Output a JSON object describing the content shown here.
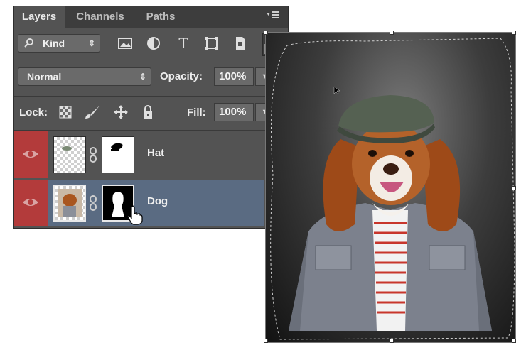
{
  "layers_panel": {
    "tabs": [
      "Layers",
      "Channels",
      "Paths"
    ],
    "active_tab": "Layers",
    "filter": {
      "kind_label": "Kind"
    },
    "blend_mode": "Normal",
    "opacity_label": "Opacity:",
    "opacity_value": "100%",
    "lock_label": "Lock:",
    "fill_label": "Fill:",
    "fill_value": "100%",
    "layers": [
      {
        "name": "Hat",
        "visible": true,
        "selected": false
      },
      {
        "name": "Dog",
        "visible": true,
        "selected": true
      }
    ]
  },
  "colors": {
    "panel_bg": "#535353",
    "tab_bar": "#3d3d3d",
    "eye_column": "#b33b3b",
    "selected_layer": "#5a6b82"
  }
}
